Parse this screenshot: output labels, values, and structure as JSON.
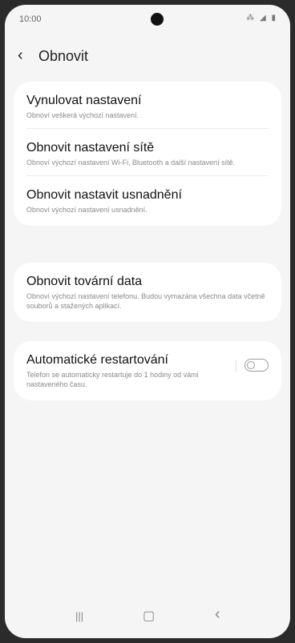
{
  "status": {
    "time": "10:00",
    "icons": "⁂ ◢ ▮"
  },
  "header": {
    "back_icon": "‹",
    "title": "Obnovit"
  },
  "card1": {
    "items": [
      {
        "title": "Vynulovat nastavení",
        "subtitle": "Obnoví veškerá výchozí nastavení."
      },
      {
        "title": "Obnovit nastavení sítě",
        "subtitle": "Obnoví výchozí nastavení Wi-Fi, Bluetooth a další nastavení sítě."
      },
      {
        "title": "Obnovit nastavit usnadnění",
        "subtitle": "Obnoví výchozí nastavení usnadnění."
      }
    ]
  },
  "card2": {
    "title": "Obnovit tovární data",
    "subtitle": "Obnoví výchozí nastavení telefonu. Budou vymazána všechna data včetně souborů a stažených aplikací."
  },
  "card3": {
    "title": "Automatické restartování",
    "subtitle": "Telefon se automaticky restartuje do 1 hodiny od vámi nastaveného času.",
    "toggle_on": false
  },
  "navbar": {
    "recent_icon": "|||",
    "home_icon": "▢",
    "back_icon": "‹"
  }
}
